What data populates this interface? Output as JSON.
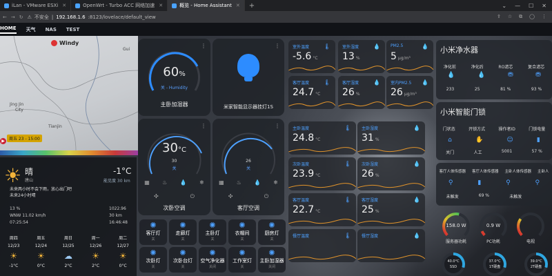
{
  "browser": {
    "tabs": [
      {
        "label": "iLan - VMware ESXi"
      },
      {
        "label": "OpenWrt - Turbo ACC 网络加速"
      },
      {
        "label": "概览 - Home Assistant"
      }
    ],
    "new_tab": "+",
    "insecure": "不安全",
    "host": "192.168.1.6",
    "url_rest": ":8123/lovelace/default_view"
  },
  "ha_nav": {
    "tabs": [
      "HOME",
      "天气",
      "NAS",
      "TEST"
    ]
  },
  "map": {
    "brand": "Windy",
    "timestamp": "周五 23 - 15:00",
    "labels": [
      "Jing Jin",
      "City",
      "Gui",
      "Tianjin"
    ]
  },
  "weather": {
    "condition": "晴",
    "location": "唐山",
    "temperature": "-1°C",
    "feels": "能见度 30 km",
    "warn1": "未来两小时不会下雨，放心出门吧",
    "warn2": "未来24小时晴",
    "humidity": "13 %",
    "wind": "WNW 11.02 km/h",
    "sunrise": "07:25:54",
    "pressure": "1022.96",
    "visibility": "30 km",
    "sunset": "16:46:48",
    "forecast": [
      {
        "day": "周四",
        "date": "12/23",
        "icon": "☀",
        "temp": "-1°C"
      },
      {
        "day": "周五",
        "date": "12/24",
        "icon": "☀",
        "temp": "0°C"
      },
      {
        "day": "周日",
        "date": "12/25",
        "icon": "☁",
        "temp": "2°C"
      },
      {
        "day": "周一",
        "date": "12/26",
        "icon": "☀",
        "temp": "2°C"
      },
      {
        "day": "周二",
        "date": "12/27",
        "icon": "☀",
        "temp": "0°C"
      }
    ]
  },
  "humidifier": {
    "value": "60",
    "unit": "%",
    "sub": "关 - Humidity",
    "name": "主卧加湿器",
    "level": 0.6
  },
  "lamp": {
    "name": "米家智能显示器挂灯1S"
  },
  "ac_bed": {
    "value": "30",
    "unit": "°C",
    "sub1": "30",
    "sub2": "关",
    "name": "次卧空调",
    "level": 0.75
  },
  "ac_living": {
    "value": "26",
    "sub2": "关",
    "name": "客厅空调",
    "level": 0.62
  },
  "sensors": [
    {
      "title": "室外温度",
      "value": "-5.6",
      "unit": "°C",
      "icon": "🌡"
    },
    {
      "title": "室外湿度",
      "value": "13",
      "unit": "%",
      "icon": "💧"
    },
    {
      "title": "PM2.5",
      "value": "5",
      "unit": "µg/m³",
      "icon": "💧"
    },
    {
      "title": "客厅温度",
      "value": "24.7",
      "unit": "°C",
      "icon": "🌡"
    },
    {
      "title": "客厅湿度",
      "value": "26",
      "unit": "%",
      "icon": "💧"
    },
    {
      "title": "室内PM2.5",
      "value": "26",
      "unit": "µg/m³",
      "icon": "💧"
    },
    {
      "title": "主卧温度",
      "value": "24.8",
      "unit": "°C",
      "icon": "🌡"
    },
    {
      "title": "主卧湿度",
      "value": "31",
      "unit": "%",
      "icon": "💧"
    },
    {
      "title": "次卧温度",
      "value": "23.9",
      "unit": "°C",
      "icon": "🌡"
    },
    {
      "title": "次卧湿度",
      "value": "26",
      "unit": "%",
      "icon": "💧"
    },
    {
      "title": "客厅温度",
      "value": "22.7",
      "unit": "°C",
      "icon": "🌡"
    },
    {
      "title": "客厅湿度",
      "value": "25",
      "unit": "%",
      "icon": "💧"
    },
    {
      "title": "餐厅温度",
      "value": "",
      "unit": "",
      "icon": "🌡"
    },
    {
      "title": "餐厅湿度",
      "value": "",
      "unit": "",
      "icon": "💧"
    }
  ],
  "buttons": [
    {
      "name": "客厅灯",
      "state": "关"
    },
    {
      "name": "走廊灯",
      "state": "关"
    },
    {
      "name": "主卧灯",
      "state": "关"
    },
    {
      "name": "衣帽间",
      "state": "关"
    },
    {
      "name": "厨房灯",
      "state": "关"
    },
    {
      "name": "次卧灯",
      "state": "关"
    },
    {
      "name": "次卧台灯",
      "state": "关"
    },
    {
      "name": "空气净化器",
      "state": "关闭"
    },
    {
      "name": "工作室灯",
      "state": "关"
    },
    {
      "name": "主卧加湿器",
      "state": "关闭"
    }
  ],
  "purifier": {
    "title": "小米净水器",
    "cols": [
      {
        "label": "净化前",
        "value": "233"
      },
      {
        "label": "净化后",
        "value": "25"
      },
      {
        "label": "RO滤芯",
        "value": "81 %"
      },
      {
        "label": "复合滤芯",
        "value": "93 %"
      }
    ]
  },
  "lock": {
    "title": "小米智能门锁",
    "cols": [
      {
        "label": "门状态",
        "value": "关门"
      },
      {
        "label": "开锁方式",
        "value": "人工"
      },
      {
        "label": "操作者ID",
        "value": "5001"
      },
      {
        "label": "门锁电量",
        "value": "57 %"
      }
    ]
  },
  "motion": {
    "cols": [
      {
        "label": "客厅人体传感器",
        "value": "未触发"
      },
      {
        "label": "客厅人体传感器",
        "value": "69 %"
      },
      {
        "label": "主卧人体传感器",
        "value": "未触发"
      },
      {
        "label": "主卧人",
        "value": ""
      }
    ]
  },
  "power": [
    {
      "value": "158.0 W",
      "name": "服务器功耗",
      "level": 0.55
    },
    {
      "value": "0.9 W",
      "name": "PC功耗",
      "level": 0.05
    },
    {
      "value": "",
      "name": "电视",
      "level": 0.3
    }
  ],
  "disks": [
    {
      "temp": "40.0°C",
      "name": "SSD"
    },
    {
      "temp": "37.0°C",
      "name": "1T硬盘"
    },
    {
      "temp": "39.0°C",
      "name": "2T硬盘"
    }
  ],
  "colors": {
    "accent": "#4ea1ff",
    "orange": "#e0932b",
    "warn": "#f3b43a"
  }
}
